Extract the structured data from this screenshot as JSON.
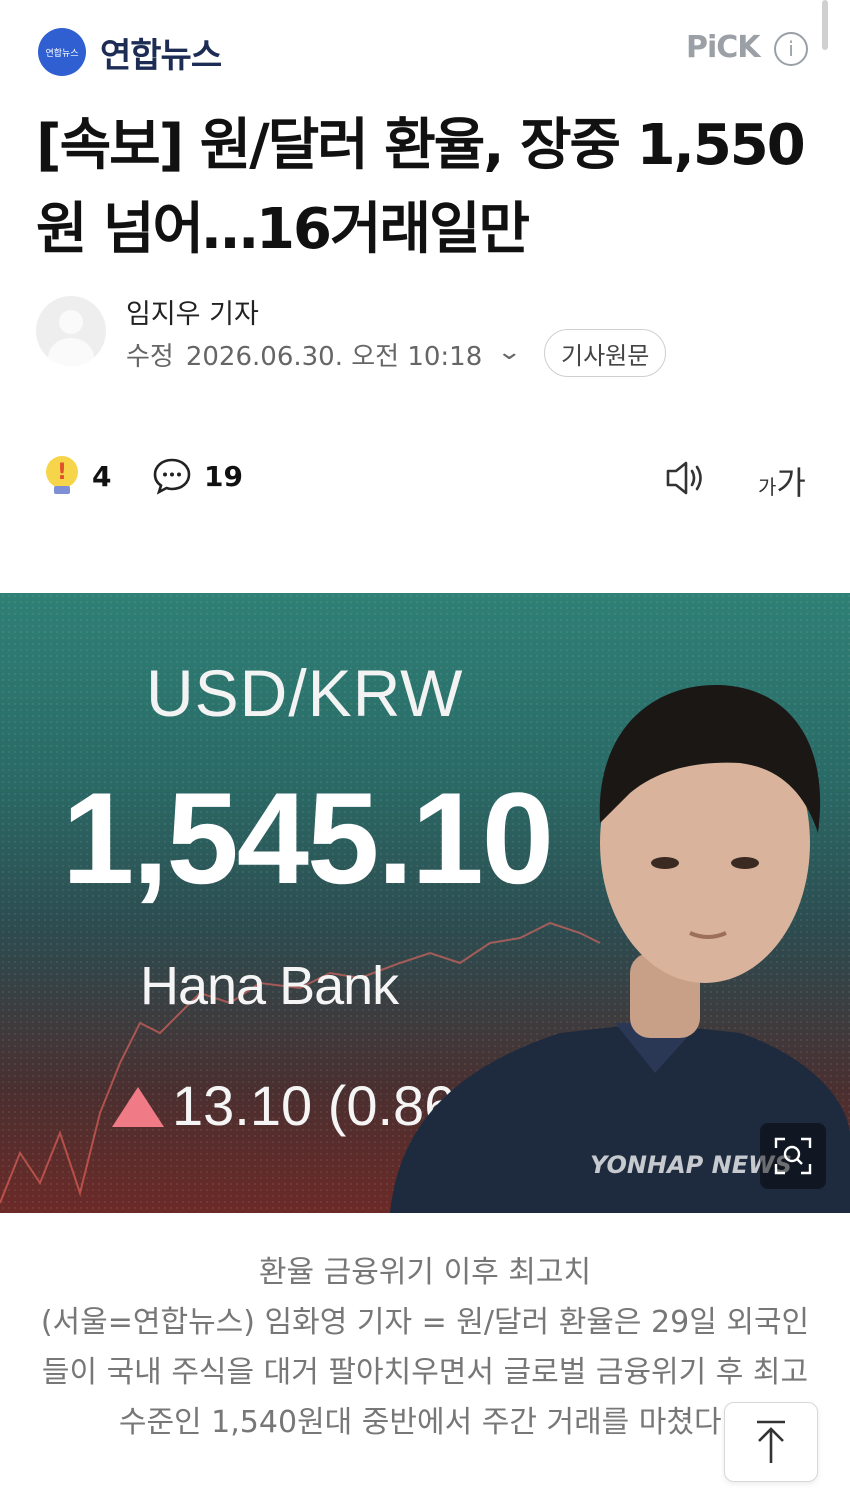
{
  "header": {
    "press_logo_text": "연합뉴스",
    "press_name": "연합뉴스",
    "pick_label": "PiCK",
    "info_icon": "info-icon"
  },
  "article": {
    "headline": "[속보] 원/달러 환율, 장중 1,550원 넘어…16거래일만",
    "author": "임지우 기자",
    "date_label": "수정",
    "datetime": "2026.06.30. 오전 10:18",
    "original_button": "기사원문"
  },
  "actions": {
    "reaction_count": "4",
    "comment_count": "19",
    "font_size_small": "가",
    "font_size_big": "가"
  },
  "photo": {
    "pair": "USD/KRW",
    "rate": "1,545.10",
    "bank": "Hana Bank",
    "change": "13.10 (0.86%)",
    "watermark": "YONHAP NEWS"
  },
  "caption": {
    "lines": [
      "환율 금융위기 이후 최고치",
      "(서울=연합뉴스) 임화영 기자 = 원/달러 환율은 29일 외국인들이 국내 주식을 대거 팔아치우면서 글로벌 금융위기 후 최고 수준인 1,540원대 중반에서 주간 거래를 마쳤다."
    ]
  },
  "colors": {
    "logo_blue": "#2f5fd0",
    "up_triangle": "#f07a85"
  }
}
